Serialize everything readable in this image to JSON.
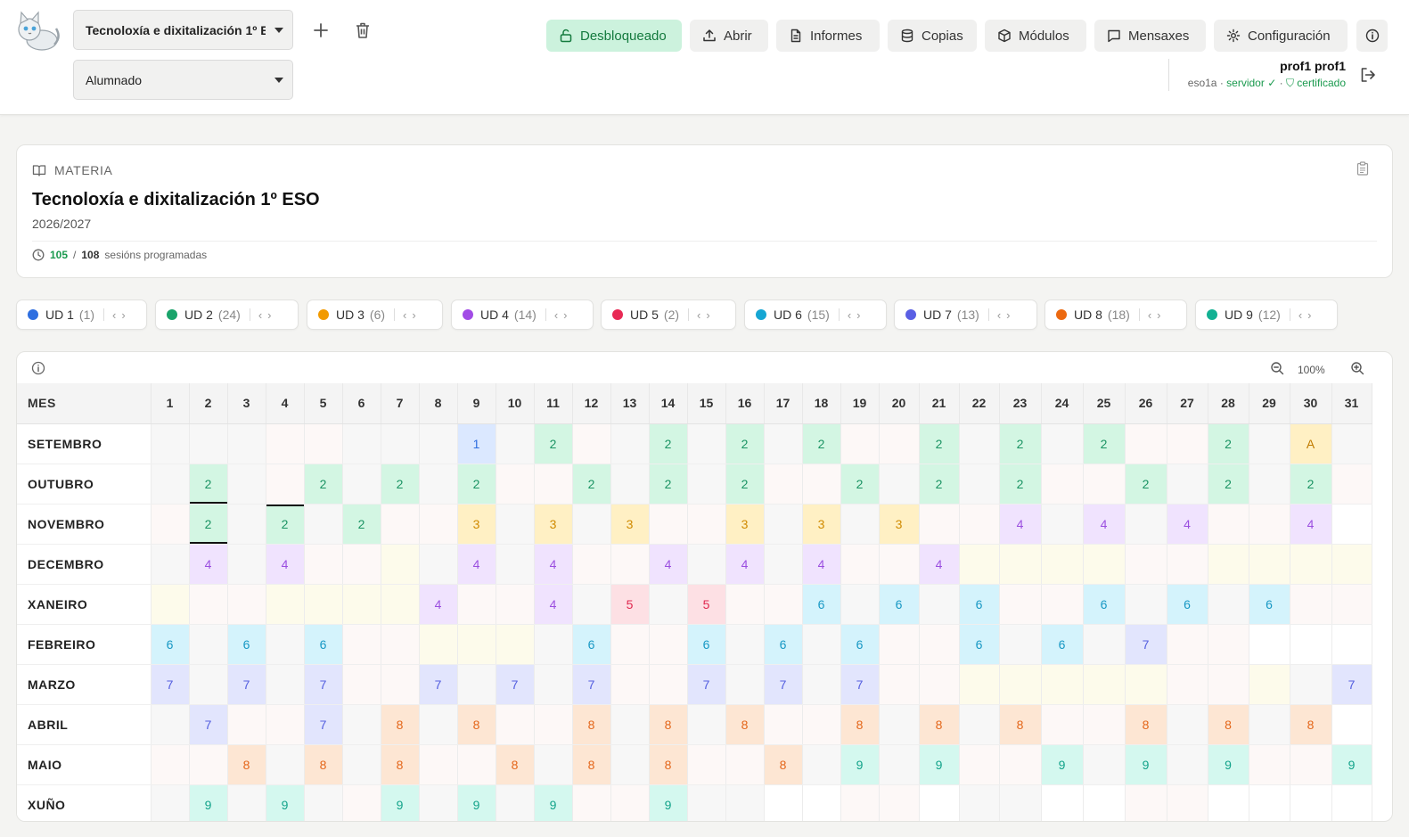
{
  "header": {
    "subject_select": "Tecnoloxía e dixitalización 1º ESO",
    "group_select": "Alumnado",
    "buttons": {
      "unlock": "Desbloqueado",
      "open": "Abrir",
      "reports": "Informes",
      "backups": "Copias",
      "modules": "Módulos",
      "messages": "Mensaxes",
      "config": "Configuración"
    },
    "user": {
      "name": "prof1 prof1",
      "host": "eso1a",
      "server": "servidor",
      "certificate": "certificado"
    }
  },
  "materia": {
    "label": "MATERIA",
    "title": "Tecnoloxía e dixitalización 1º ESO",
    "year": "2026/2027",
    "sessions_done": "105",
    "sessions_total": "108",
    "sessions_label": "sesións programadas"
  },
  "units": [
    {
      "label": "UD 1",
      "count": "(1)",
      "color": "#2f6fe0"
    },
    {
      "label": "UD 2",
      "count": "(24)",
      "color": "#1aa46b"
    },
    {
      "label": "UD 3",
      "count": "(6)",
      "color": "#f29a00"
    },
    {
      "label": "UD 4",
      "count": "(14)",
      "color": "#a24ce6"
    },
    {
      "label": "UD 5",
      "count": "(2)",
      "color": "#e82a55"
    },
    {
      "label": "UD 6",
      "count": "(15)",
      "color": "#16a6d3"
    },
    {
      "label": "UD 7",
      "count": "(13)",
      "color": "#5a5fe4"
    },
    {
      "label": "UD 8",
      "count": "(18)",
      "color": "#ec6910"
    },
    {
      "label": "UD 9",
      "count": "(12)",
      "color": "#13b193"
    }
  ],
  "calendar": {
    "zoom": "100%",
    "month_header": "MES",
    "days": [
      "1",
      "2",
      "3",
      "4",
      "5",
      "6",
      "7",
      "8",
      "9",
      "10",
      "11",
      "12",
      "13",
      "14",
      "15",
      "16",
      "17",
      "18",
      "19",
      "20",
      "21",
      "22",
      "23",
      "24",
      "25",
      "26",
      "27",
      "28",
      "29",
      "30",
      "31"
    ],
    "months": [
      {
        "name": "SETEMBRO",
        "cells": [
          "wk",
          "wk",
          "wk",
          "hol",
          "hol",
          "wk",
          "wk",
          "wk",
          "1",
          "wk",
          "2",
          "hol",
          "wk",
          "2",
          "wk",
          "2",
          "wk",
          "2",
          "hol",
          "hol",
          "2",
          "wk",
          "2",
          "wk",
          "2",
          "hol",
          "hol",
          "2",
          "wk",
          "A",
          "wk"
        ]
      },
      {
        "name": "OUTUBRO",
        "cells": [
          "wk",
          "2",
          "wk",
          "hol",
          "2",
          "wk",
          "2",
          "wk",
          "2",
          "hol",
          "hol",
          "2",
          "wk",
          "2",
          "wk",
          "2",
          "hol",
          "hol",
          "2",
          "wk",
          "2",
          "wk",
          "2",
          "hol",
          "hol",
          "2",
          "wk",
          "2",
          "wk",
          "2",
          "hol"
        ]
      },
      {
        "name": "NOVEMBRO",
        "cells": [
          "hol",
          "2",
          "wk",
          "2",
          "wk",
          "2",
          "hol",
          "hol",
          "3",
          "wk",
          "3",
          "wk",
          "3",
          "hol",
          "hol",
          "3",
          "wk",
          "3",
          "wk",
          "3",
          "hol",
          "hol",
          "4",
          "wk",
          "4",
          "wk",
          "4",
          "hol",
          "hol",
          "4",
          "nod"
        ]
      },
      {
        "name": "DECEMBRO",
        "cells": [
          "wk",
          "4",
          "wk",
          "4",
          "hol",
          "hol",
          "vac",
          "wk",
          "4",
          "wk",
          "4",
          "hol",
          "hol",
          "4",
          "wk",
          "4",
          "wk",
          "4",
          "hol",
          "hol",
          "4",
          "vac",
          "vac",
          "vac",
          "vac",
          "hol",
          "hol",
          "vac",
          "vac",
          "vac",
          "vac"
        ]
      },
      {
        "name": "XANEIRO",
        "cells": [
          "vac",
          "hol",
          "hol",
          "vac",
          "vac",
          "vac",
          "vac",
          "4",
          "hol",
          "hol",
          "4",
          "wk",
          "5",
          "wk",
          "5",
          "hol",
          "hol",
          "6",
          "wk",
          "6",
          "wk",
          "6",
          "hol",
          "hol",
          "6",
          "wk",
          "6",
          "wk",
          "6",
          "hol",
          "hol"
        ]
      },
      {
        "name": "FEBREIRO",
        "cells": [
          "6",
          "wk",
          "6",
          "wk",
          "6",
          "hol",
          "hol",
          "vac",
          "vac",
          "vac",
          "wk",
          "6",
          "hol",
          "hol",
          "6",
          "wk",
          "6",
          "wk",
          "6",
          "hol",
          "hol",
          "6",
          "wk",
          "6",
          "wk",
          "7",
          "hol",
          "hol",
          "nod",
          "nod",
          "nod"
        ]
      },
      {
        "name": "MARZO",
        "cells": [
          "7",
          "wk",
          "7",
          "wk",
          "7",
          "hol",
          "hol",
          "7",
          "wk",
          "7",
          "wk",
          "7",
          "hol",
          "hol",
          "7",
          "wk",
          "7",
          "wk",
          "7",
          "hol",
          "hol",
          "vac",
          "vac",
          "vac",
          "vac",
          "vac",
          "hol",
          "hol",
          "vac",
          "wk",
          "7"
        ]
      },
      {
        "name": "ABRIL",
        "cells": [
          "wk",
          "7",
          "hol",
          "hol",
          "7",
          "wk",
          "8",
          "wk",
          "8",
          "hol",
          "hol",
          "8",
          "wk",
          "8",
          "wk",
          "8",
          "hol",
          "hol",
          "8",
          "wk",
          "8",
          "wk",
          "8",
          "hol",
          "hol",
          "8",
          "wk",
          "8",
          "wk",
          "8",
          "nod"
        ]
      },
      {
        "name": "MAIO",
        "cells": [
          "hol",
          "hol",
          "8",
          "wk",
          "8",
          "wk",
          "8",
          "hol",
          "hol",
          "8",
          "wk",
          "8",
          "wk",
          "8",
          "hol",
          "hol",
          "8",
          "wk",
          "9",
          "wk",
          "9",
          "hol",
          "hol",
          "9",
          "wk",
          "9",
          "wk",
          "9",
          "hol",
          "hol",
          "9"
        ]
      },
      {
        "name": "XUÑO",
        "cells": [
          "wk",
          "9",
          "wk",
          "9",
          "wk",
          "hol",
          "9",
          "wk",
          "9",
          "wk",
          "9",
          "hol",
          "hol",
          "9",
          "wk",
          "wk",
          "nod",
          "nod",
          "hol",
          "hol",
          "nod",
          "wk",
          "wk",
          "nod",
          "nod",
          "hol",
          "hol",
          "nod",
          "nod",
          "nod",
          "nod"
        ]
      }
    ],
    "markers": [
      {
        "month": 1,
        "day": 2,
        "type": "ul"
      },
      {
        "month": 2,
        "day": 2,
        "type": "ul"
      },
      {
        "month": 2,
        "day": 4,
        "type": "ul"
      },
      {
        "month": 2,
        "day": 4,
        "type": "ol"
      }
    ]
  }
}
